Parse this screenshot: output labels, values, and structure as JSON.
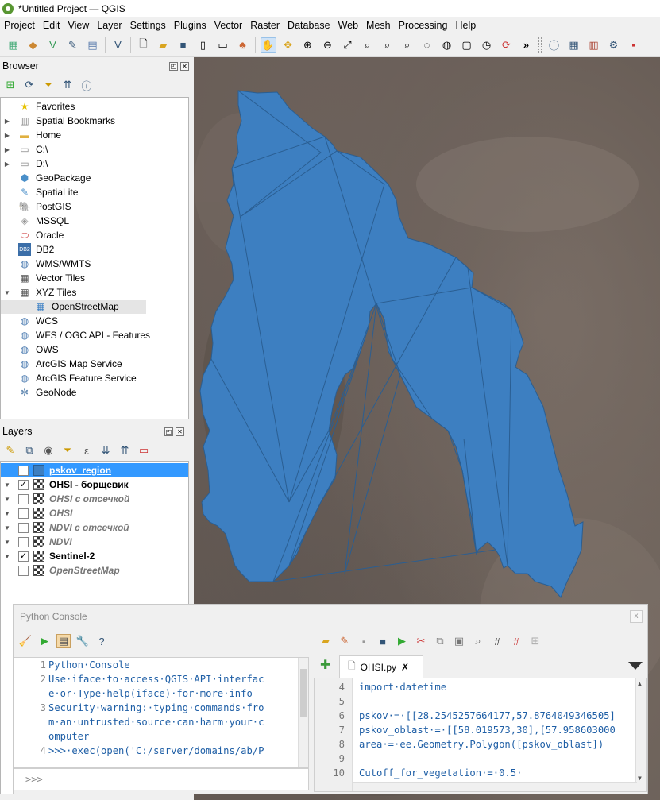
{
  "window": {
    "title": "*Untitled Project — QGIS"
  },
  "menu": [
    {
      "label": "Project"
    },
    {
      "label": "Edit"
    },
    {
      "label": "View"
    },
    {
      "label": "Layer"
    },
    {
      "label": "Settings"
    },
    {
      "label": "Plugins"
    },
    {
      "label": "Vector"
    },
    {
      "label": "Raster"
    },
    {
      "label": "Database"
    },
    {
      "label": "Web"
    },
    {
      "label": "Mesh"
    },
    {
      "label": "Processing"
    },
    {
      "label": "Help"
    }
  ],
  "toolbar": {
    "more_glyph": "»"
  },
  "browser": {
    "title": "Browser",
    "items": [
      {
        "label": "Favorites",
        "icon": "star-icon"
      },
      {
        "label": "Spatial Bookmarks",
        "icon": "bookmark-icon"
      },
      {
        "label": "Home",
        "icon": "folder-icon"
      },
      {
        "label": "C:\\",
        "icon": "drive-icon"
      },
      {
        "label": "D:\\",
        "icon": "drive-icon"
      },
      {
        "label": "GeoPackage",
        "icon": "geopackage-icon"
      },
      {
        "label": "SpatiaLite",
        "icon": "spatialite-icon"
      },
      {
        "label": "PostGIS",
        "icon": "postgis-icon"
      },
      {
        "label": "MSSQL",
        "icon": "mssql-icon"
      },
      {
        "label": "Oracle",
        "icon": "oracle-icon"
      },
      {
        "label": "DB2",
        "icon": "db2-icon"
      },
      {
        "label": "WMS/WMTS",
        "icon": "globe-icon"
      },
      {
        "label": "Vector Tiles",
        "icon": "grid-icon"
      },
      {
        "label": "XYZ Tiles",
        "icon": "grid-icon"
      },
      {
        "label": "OpenStreetMap",
        "icon": "grid-icon"
      },
      {
        "label": "WCS",
        "icon": "globe-icon"
      },
      {
        "label": "WFS / OGC API - Features",
        "icon": "globe-icon"
      },
      {
        "label": "OWS",
        "icon": "globe-icon"
      },
      {
        "label": "ArcGIS Map Service",
        "icon": "globe-icon"
      },
      {
        "label": "ArcGIS Feature Service",
        "icon": "globe-icon"
      },
      {
        "label": "GeoNode",
        "icon": "geonode-icon"
      }
    ]
  },
  "layers": {
    "title": "Layers",
    "items": [
      {
        "label": "pskov_region",
        "checked": "✓"
      },
      {
        "label": "OHSI - борщевик",
        "checked": "✓"
      },
      {
        "label": "OHSI с отсечкой",
        "checked": ""
      },
      {
        "label": "OHSI",
        "checked": ""
      },
      {
        "label": "NDVI с отсечкой",
        "checked": ""
      },
      {
        "label": "NDVI",
        "checked": ""
      },
      {
        "label": "Sentinel-2",
        "checked": "✓"
      },
      {
        "label": "OpenStreetMap",
        "checked": ""
      }
    ]
  },
  "console": {
    "title": "Python Console",
    "close_glyph": "x",
    "shell_lines": [
      {
        "n": "1",
        "text": "Python·Console"
      },
      {
        "n": "2",
        "text": "Use·iface·to·access·QGIS·API·interfac"
      },
      {
        "n": "",
        "text": "e·or·Type·help(iface)·for·more·info"
      },
      {
        "n": "3",
        "text": "Security·warning:·typing·commands·fro"
      },
      {
        "n": "",
        "text": "m·an·untrusted·source·can·harm·your·c"
      },
      {
        "n": "",
        "text": "omputer"
      },
      {
        "n": "4",
        "text": ">>>·exec(open('C:/server/domains/ab/P"
      }
    ],
    "prompt": ">>>",
    "editor_tab": "OHSI.py",
    "editor_lines": [
      {
        "n": "4",
        "text": "import·datetime"
      },
      {
        "n": "5",
        "text": ""
      },
      {
        "n": "6",
        "text": "pskov·=·[[28.2545257664177,57.8764049346505]"
      },
      {
        "n": "7",
        "text": "pskov_oblast·=·[[58.019573,30],[57.958603000"
      },
      {
        "n": "8",
        "text": "area·=·ee.Geometry.Polygon([pskov_oblast])"
      },
      {
        "n": "9",
        "text": ""
      },
      {
        "n": "10",
        "text": "Cutoff_for_vegetation·=·0.5·"
      }
    ]
  },
  "colors": {
    "polygon_fill": "#3d7fc1",
    "polygon_stroke": "#2a5e92",
    "selection": "#3399ff"
  }
}
